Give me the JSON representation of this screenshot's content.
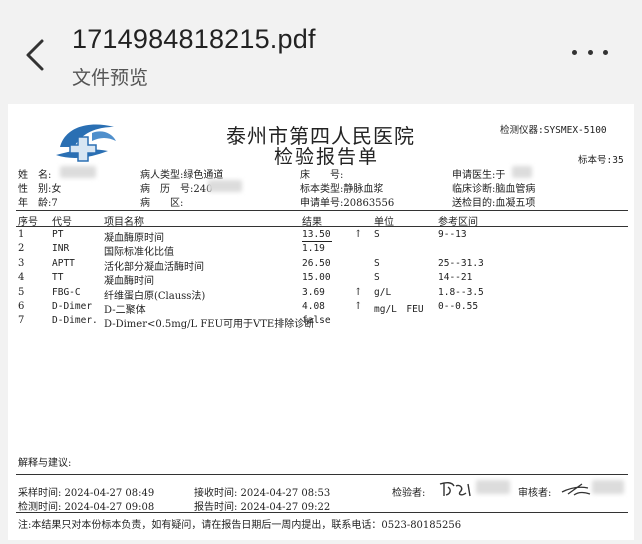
{
  "header": {
    "filename": "1714984818215.pdf",
    "subtitle": "文件预览"
  },
  "report": {
    "hospital": "泰州市第四人民医院",
    "title": "检验报告单",
    "instrument": "检测仪器:SYSMEX-5100",
    "sample_no": "标本号:35",
    "info": {
      "name_label": "姓　名:",
      "patient_type": "病人类型:绿色通道",
      "bed_label": "床　　号:",
      "doctor": "申请医生:于",
      "sex": "性　别:女",
      "record_no": "病　历　号:240",
      "sample_type": "标本类型:静脉血浆",
      "diagnosis": "临床诊断:脑血管病",
      "age": "年　龄:7",
      "ward": "病　　区:",
      "request_no": "申请单号:20863556",
      "purpose": "送检目的:血凝五项"
    },
    "columns": [
      "序号",
      "代号",
      "项目名称",
      "结果",
      "单位",
      "参考区间"
    ],
    "rows": [
      {
        "no": "1",
        "code": "PT",
        "name": "凝血酶原时间",
        "result": "13.50",
        "flag": "↑",
        "unit": "S",
        "ref": "9--13"
      },
      {
        "no": "2",
        "code": "INR",
        "name": "国际标准化比值",
        "result": "1.19",
        "flag": "",
        "unit": "",
        "ref": ""
      },
      {
        "no": "3",
        "code": "APTT",
        "name": "活化部分凝血活酶时间",
        "result": "26.50",
        "flag": "",
        "unit": "S",
        "ref": "25--31.3"
      },
      {
        "no": "4",
        "code": "TT",
        "name": "凝血酶时间",
        "result": "15.00",
        "flag": "",
        "unit": "S",
        "ref": "14--21"
      },
      {
        "no": "5",
        "code": "FBG-C",
        "name": "纤维蛋白原(Clauss法)",
        "result": "3.69",
        "flag": "↑",
        "unit": "g/L",
        "ref": "1.8--3.5"
      },
      {
        "no": "6",
        "code": "D-Dimer",
        "name": "D-二聚体",
        "result": "4.08",
        "flag": "↑",
        "unit": "mg/L　FEU",
        "ref": "0--0.55"
      },
      {
        "no": "7",
        "code": "D-Dimer.",
        "name": "D-Dimer<0.5mg/L FEU可用于VTE排除诊断",
        "result": "false",
        "flag": "",
        "unit": "",
        "ref": ""
      }
    ],
    "footer": {
      "advice": "解释与建议:",
      "collect_time": "采样时间: 2024-04-27 08:49",
      "receive_time": "接收时间: 2024-04-27 08:53",
      "test_time": "检测时间: 2024-04-27 09:08",
      "report_time": "报告时间: 2024-04-27 09:22",
      "tester": "检验者:",
      "reviewer": "审核者:",
      "note": "注:本结果只对本份标本负责，如有疑问，请在报告日期后一周内提出，联系电话：0523-80185256"
    }
  }
}
